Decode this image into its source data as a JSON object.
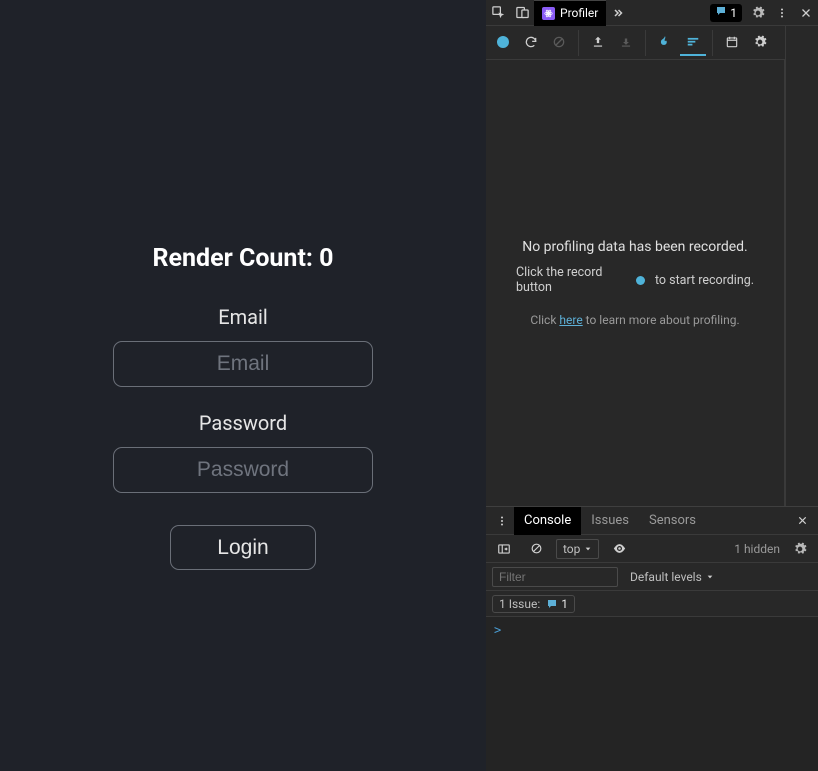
{
  "app": {
    "title": "Render Count: 0",
    "email_label": "Email",
    "email_placeholder": "Email",
    "password_label": "Password",
    "password_placeholder": "Password",
    "login_label": "Login"
  },
  "devtools": {
    "tabs": {
      "profiler": "Profiler",
      "issues_count": "1"
    },
    "profiler": {
      "msg_nodata": "No profiling data has been recorded.",
      "msg_click_a": "Click the record button",
      "msg_click_b": "to start recording.",
      "msg_learn_pre": "Click ",
      "msg_learn_link": "here",
      "msg_learn_post": " to learn more about profiling."
    },
    "console": {
      "tabs": {
        "console": "Console",
        "issues": "Issues",
        "sensors": "Sensors"
      },
      "context": "top",
      "hidden": "1 hidden",
      "filter_placeholder": "Filter",
      "levels": "Default levels",
      "issue_label": "1 Issue:",
      "issue_count": "1",
      "prompt": ">"
    }
  }
}
